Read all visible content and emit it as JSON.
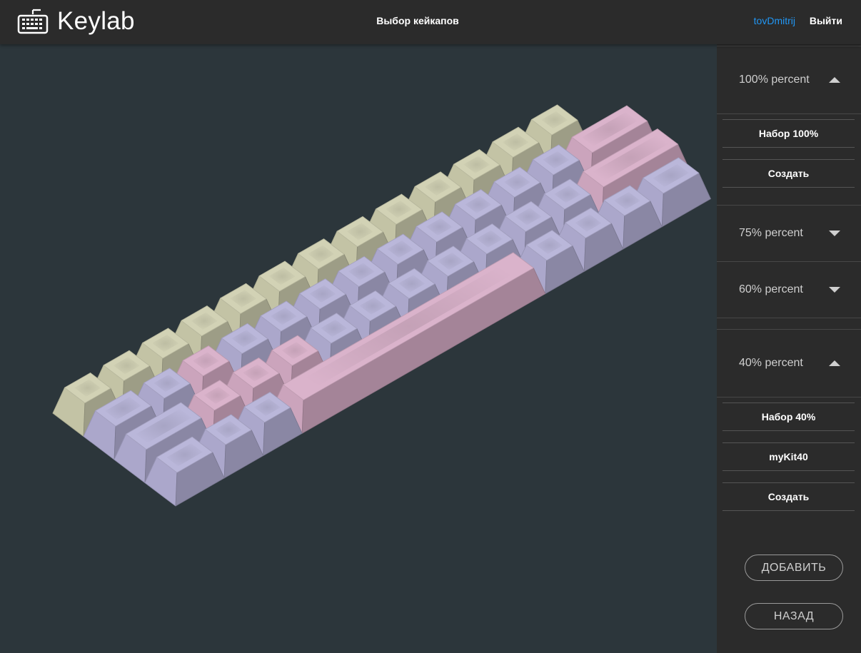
{
  "app": {
    "name": "Keylab",
    "page_title": "Выбор кейкапов"
  },
  "user": {
    "name": "tovDmitrij",
    "logout_label": "Выйти"
  },
  "sidebar": {
    "sections": [
      {
        "label": "100% percent",
        "expanded": true,
        "kits": [
          "Набор 100%"
        ],
        "create_label": "Создать"
      },
      {
        "label": "75% percent",
        "expanded": false
      },
      {
        "label": "60% percent",
        "expanded": false
      },
      {
        "label": "40% percent",
        "expanded": true,
        "kits": [
          "Набор 40%",
          "myKit40"
        ],
        "create_label": "Создать"
      }
    ],
    "add_button": "ДОБАВИТЬ",
    "back_button": "НАЗАД"
  },
  "keyboard": {
    "layout": "40%",
    "colors": {
      "alpha_row": "#cfcfb0",
      "mods": "#b6b2d8",
      "accent": "#d8aec8",
      "background": "#2c363b"
    },
    "icons": [
      "keyboard-icon",
      "chevron-up-icon",
      "chevron-down-icon"
    ]
  }
}
